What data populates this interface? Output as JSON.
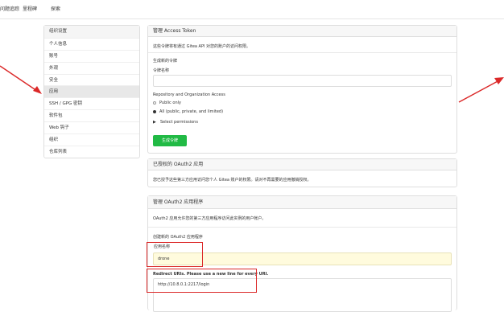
{
  "topnav": {
    "item1": "问题追踪",
    "item2": "里程碑",
    "item3": "探索"
  },
  "sidebar": {
    "header": "组织设置",
    "items": [
      {
        "label": "个人信息"
      },
      {
        "label": "账号"
      },
      {
        "label": "外观"
      },
      {
        "label": "安全"
      },
      {
        "label": "应用"
      },
      {
        "label": "SSH / GPG 密钥"
      },
      {
        "label": "软件包"
      },
      {
        "label": "Web 钩子"
      },
      {
        "label": "组织"
      },
      {
        "label": "仓库列表"
      }
    ]
  },
  "tokens": {
    "title": "管理 Access Token",
    "desc": "这些令牌将有通过 Gitea API 对您的账户的访问权限。",
    "generate_heading": "生成新的令牌",
    "name_label": "令牌名称",
    "scope_heading": "Repository and Organization Access",
    "opt_public": "Public only",
    "opt_all": "All (public, private, and limited)",
    "select_permissions": "Select permissions",
    "generate_button": "生成令牌"
  },
  "authorized": {
    "title": "已授权的 OAuth2 应用",
    "desc": "您已授予这些第三方应用访问您个人 Gitea 账户的权限。请对不再需要的应用撤销授权。"
  },
  "oauth": {
    "title": "管理 OAuth2 应用程序",
    "desc": "OAuth2 应用允许您的第三方应用程序访问此实例的用户帐户。",
    "create_heading": "创建新的 OAuth2 应用程序",
    "app_name_label": "应用名称",
    "app_name_value": "drone",
    "redirect_label": "Redirect URIs. Please use a new line for every URI.",
    "redirect_value": "http://10.8.0.1:2217/login"
  },
  "colors": {
    "primary_button": "#21ba45",
    "highlight_box": "#db2828",
    "autofill": "#fffbdd"
  }
}
